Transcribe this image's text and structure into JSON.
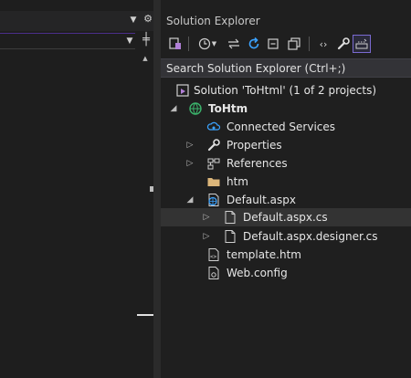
{
  "editor": {
    "dropdown_icon": "chevron-down-icon",
    "gear_icon": "gear-icon",
    "split_icon": "split-icon"
  },
  "solution_explorer": {
    "title": "Solution Explorer",
    "search_placeholder": "Search Solution Explorer (Ctrl+;)",
    "toolbar": [
      {
        "name": "switch-views-button",
        "icon": "switch-views-icon"
      },
      {
        "name": "pending-changes-filter-button",
        "icon": "clock-icon"
      },
      {
        "name": "sync-button",
        "icon": "sync-arrows-icon"
      },
      {
        "name": "refresh-button",
        "icon": "refresh-icon"
      },
      {
        "name": "collapse-all-button",
        "icon": "collapse-icon"
      },
      {
        "name": "show-all-files-button",
        "icon": "show-all-files-icon"
      },
      {
        "name": "view-code-button",
        "icon": "code-brackets-icon"
      },
      {
        "name": "properties-button",
        "icon": "wrench-icon"
      },
      {
        "name": "preview-selected-button",
        "icon": "preview-icon",
        "active": true
      }
    ],
    "tree": [
      {
        "label": "Solution 'ToHtml' (1 of 2 projects)",
        "icon": "solution-icon",
        "expander": ""
      },
      {
        "label": "ToHtm",
        "icon": "web-project-icon",
        "expander": "◢",
        "bold": true
      },
      {
        "label": "Connected Services",
        "icon": "connected-services-icon",
        "expander": ""
      },
      {
        "label": "Properties",
        "icon": "wrench-icon",
        "expander": "▷"
      },
      {
        "label": "References",
        "icon": "references-icon",
        "expander": "▷"
      },
      {
        "label": "htm",
        "icon": "folder-icon",
        "expander": ""
      },
      {
        "label": "Default.aspx",
        "icon": "aspx-file-icon",
        "expander": "◢"
      },
      {
        "label": "Default.aspx.cs",
        "icon": "cs-file-icon",
        "expander": "▷",
        "selected": true
      },
      {
        "label": "Default.aspx.designer.cs",
        "icon": "cs-file-icon",
        "expander": "▷"
      },
      {
        "label": "template.htm",
        "icon": "html-file-icon",
        "expander": ""
      },
      {
        "label": "Web.config",
        "icon": "config-file-icon",
        "expander": ""
      }
    ]
  },
  "colors": {
    "background": "#1f1f1f",
    "accent": "#7a6ad1",
    "selection": "#333333",
    "folder": "#dcb67a"
  }
}
